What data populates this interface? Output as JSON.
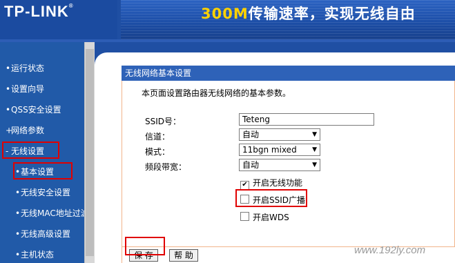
{
  "header": {
    "logo": "TP-LINK",
    "logo_reg": "®",
    "banner_highlight": "300M",
    "banner_text": "传输速率，实现无线自由"
  },
  "sidebar": {
    "items": [
      {
        "bullet": "•",
        "label": "运行状态"
      },
      {
        "bullet": "•",
        "label": "设置向导"
      },
      {
        "bullet": "•",
        "label": "QSS安全设置"
      },
      {
        "bullet": "+",
        "label": "网络参数"
      },
      {
        "bullet": "-",
        "label": "无线设置"
      },
      {
        "bullet": "•",
        "label": "基本设置"
      },
      {
        "bullet": "•",
        "label": "无线安全设置"
      },
      {
        "bullet": "•",
        "label": "无线MAC地址过滤"
      },
      {
        "bullet": "•",
        "label": "无线高级设置"
      },
      {
        "bullet": "•",
        "label": "主机状态"
      }
    ]
  },
  "panel": {
    "title": "无线网络基本设置",
    "intro": "本页面设置路由器无线网络的基本参数。",
    "ssid_label": "SSID号：",
    "ssid_value": "Teteng",
    "channel_label": "信道：",
    "channel_value": "自动",
    "mode_label": "模式：",
    "mode_value": "11bgn mixed",
    "bandwidth_label": "频段带宽：",
    "bandwidth_value": "自动",
    "select_arrow": "▼",
    "cb_wireless": "开启无线功能",
    "cb_wireless_checked": true,
    "cb_ssid_broadcast": "开启SSID广播",
    "cb_ssid_broadcast_checked": false,
    "cb_wds": "开启WDS",
    "cb_wds_checked": false,
    "check_mark": "✔",
    "save_label": "保 存",
    "help_label": "帮 助"
  },
  "watermark": "www.192ly.com",
  "colors": {
    "header_blue": "#1f4fa3",
    "highlight_red": "#e00000",
    "banner_yellow": "#ffd200"
  }
}
